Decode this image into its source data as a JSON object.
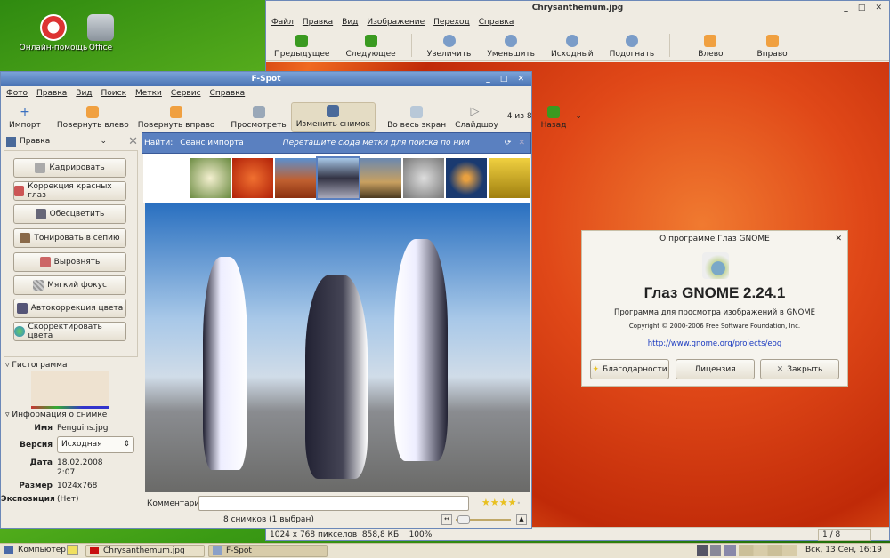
{
  "desktop": {
    "icons": [
      {
        "label": "Онлайн-помощь"
      },
      {
        "label": "Office"
      }
    ]
  },
  "eog": {
    "title": "Chrysanthemum.jpg",
    "menu": [
      "Файл",
      "Правка",
      "Вид",
      "Изображение",
      "Переход",
      "Справка"
    ],
    "toolbar": [
      "Предыдущее",
      "Следующее",
      "Увеличить",
      "Уменьшить",
      "Исходный",
      "Подогнать",
      "Влево",
      "Вправо"
    ],
    "status": "1024 x 768 пикселов  858,8 КБ    100%",
    "page": "1 / 8"
  },
  "fspot": {
    "title": "F-Spot",
    "menu": [
      "Фото",
      "Правка",
      "Вид",
      "Поиск",
      "Метки",
      "Сервис",
      "Справка"
    ],
    "toolbar": [
      "Импорт",
      "Повернуть влево",
      "Повернуть вправо",
      "Просмотреть",
      "Изменить снимок",
      "Во весь экран",
      "Слайдшоу",
      "4 из 8",
      "Назад"
    ],
    "sidebar": {
      "title": "Правка",
      "buttons": [
        "Кадрировать",
        "Коррекция красных глаз",
        "Обесцветить",
        "Тонировать в сепию",
        "Выровнять",
        "Мягкий фокус",
        "Автокоррекция цвета",
        "Скорректировать цвета"
      ],
      "histogram_label": "Гистограмма",
      "info_label": "Информация о снимке",
      "info": {
        "name_label": "Имя",
        "name": "Penguins.jpg",
        "version_label": "Версия",
        "version": "Исходная",
        "date_label": "Дата",
        "date": "18.02.2008",
        "time": "2:07",
        "size_label": "Размер",
        "size": "1024x768",
        "exposure_label": "Экспозиция",
        "exposure": "(Нет)"
      }
    },
    "findbar": {
      "label": "Найти:",
      "tag": "Сеанс импорта",
      "hint": "Перетащите сюда метки для поиска по ним"
    },
    "comment_label": "Комментарий:",
    "comment": "",
    "rating": 4,
    "status": "8 снимков (1 выбран)"
  },
  "about": {
    "title": "О программе Глаз GNOME",
    "name": "Глаз GNOME 2.24.1",
    "desc": "Программа для просмотра изображений в GNOME",
    "copyright": "Copyright © 2000-2006 Free Software Foundation, Inc.",
    "link": "http://www.gnome.org/projects/eog",
    "buttons": [
      "Благодарности",
      "Лицензия",
      "Закрыть"
    ]
  },
  "taskbar": {
    "computer": "Компьютер",
    "tasks": [
      "Chrysanthemum.jpg",
      "F-Spot"
    ],
    "clock": "Вск, 13 Сен, 16:19"
  }
}
